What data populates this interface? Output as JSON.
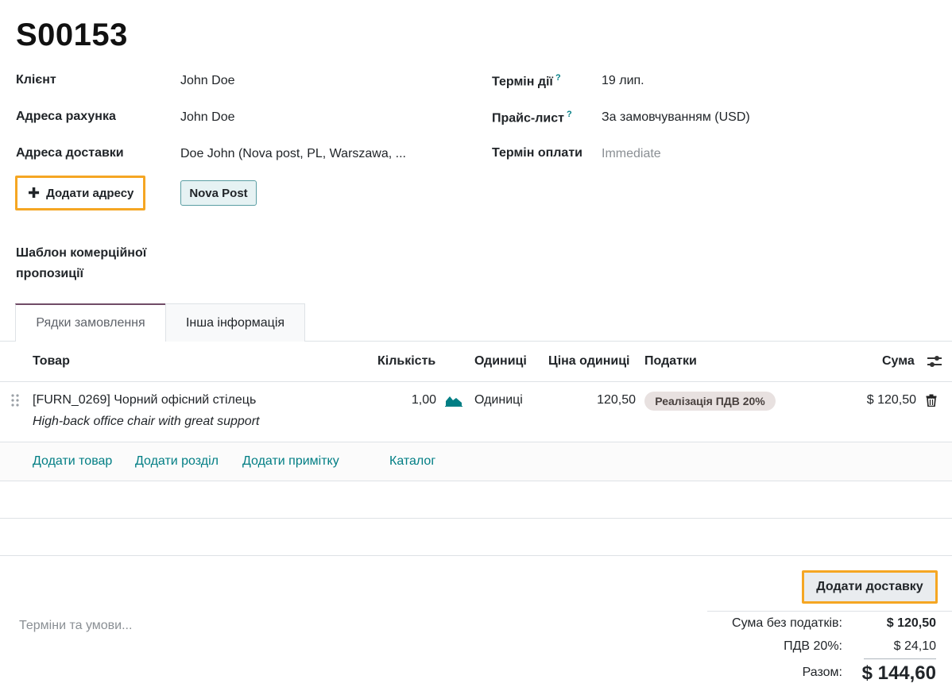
{
  "order": {
    "number": "S00153"
  },
  "left_fields": {
    "customer_label": "Клієнт",
    "customer_value": "John Doe",
    "invoice_address_label": "Адреса рахунка",
    "invoice_address_value": "John Doe",
    "delivery_address_label": "Адреса доставки",
    "delivery_address_value": "Doe John (Nova post, PL, Warszawa, ...",
    "add_address_button": "Додати адресу",
    "nova_post_button": "Nova Post",
    "quotation_template_label_line1": "Шаблон комерційної",
    "quotation_template_label_line2": "пропозиції"
  },
  "right_fields": {
    "validity_label": "Термін дії",
    "validity_value": "19 лип.",
    "pricelist_label": "Прайс-лист",
    "pricelist_value": "За замовчуванням (USD)",
    "payment_terms_label": "Термін оплати",
    "payment_terms_placeholder": "Immediate",
    "help_mark": "?"
  },
  "tabs": [
    {
      "label": "Рядки замовлення",
      "active": true
    },
    {
      "label": "Інша інформація",
      "active": false
    }
  ],
  "table": {
    "headers": {
      "product": "Товар",
      "quantity": "Кількість",
      "uom": "Одиниці",
      "unit_price": "Ціна одиниці",
      "taxes": "Податки",
      "subtotal": "Сума"
    },
    "rows": [
      {
        "product": "[FURN_0269] Чорний офісний стілець",
        "description": "High-back office chair with great support",
        "quantity": "1,00",
        "uom": "Одиниці",
        "unit_price": "120,50",
        "tax": "Реалізація ПДВ 20%",
        "subtotal": "$ 120,50"
      }
    ],
    "add_links": {
      "add_product": "Додати товар",
      "add_section": "Додати розділ",
      "add_note": "Додати примітку",
      "catalog": "Каталог"
    }
  },
  "footer": {
    "terms_placeholder": "Терміни та умови...",
    "add_shipping_button": "Додати доставку",
    "untaxed_label": "Сума без податків:",
    "untaxed_value": "$ 120,50",
    "vat_label": "ПДВ 20%:",
    "vat_value": "$ 24,10",
    "total_label": "Разом:",
    "total_value": "$ 144,60"
  },
  "colors": {
    "accent": "#017e84",
    "highlight": "#f5a623",
    "tab_active": "#714b67"
  }
}
